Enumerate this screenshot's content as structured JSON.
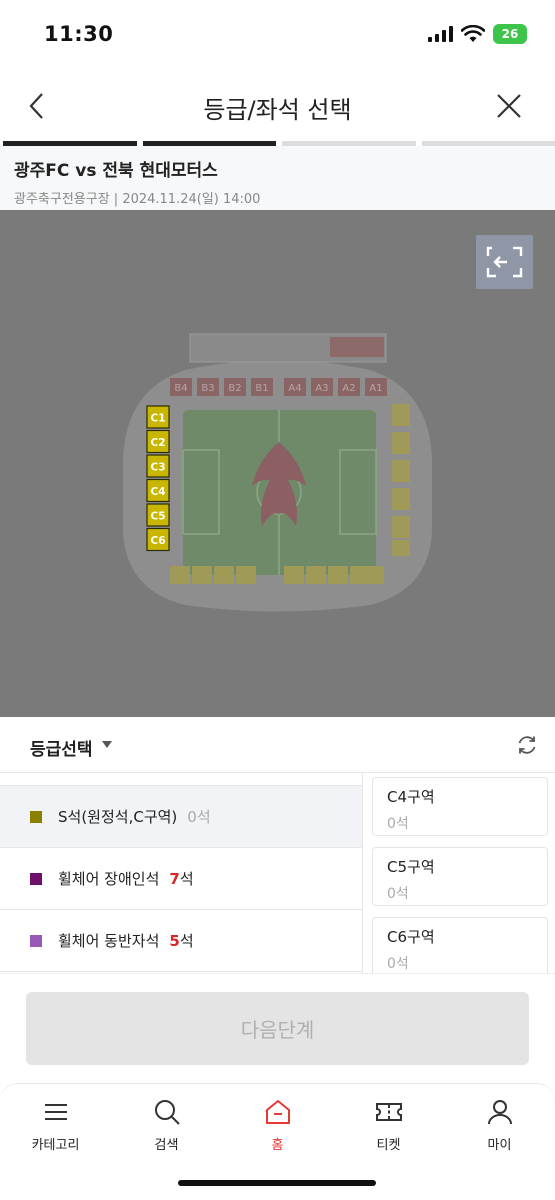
{
  "status_bar": {
    "time": "11:30",
    "battery": "26"
  },
  "header": {
    "title": "등급/좌석 선택"
  },
  "progress": {
    "steps": 4,
    "completed": 2,
    "active_color": "#222222",
    "inactive_color": "#dddddd"
  },
  "match": {
    "title": "광주FC vs 전북 현대모터스",
    "venue_datetime": "광주축구전용구장 | 2024.11.24(일) 14:00"
  },
  "stadium_map": {
    "top_blocks": [
      "B4",
      "B3",
      "B2",
      "B1",
      "A4",
      "A3",
      "A2",
      "A1"
    ],
    "left_blocks": [
      "C1",
      "C2",
      "C3",
      "C4",
      "C5",
      "C6"
    ],
    "accent_color": "#c8b600"
  },
  "grade_selector": {
    "label": "등급선택"
  },
  "grades": [
    {
      "color": "#8a8000",
      "name": "S석(원정석,C구역)",
      "count_num": "0",
      "count_unit": "석",
      "highlight": false,
      "selected": true
    },
    {
      "color": "#6d0f6d",
      "name": "휠체어 장애인석",
      "count_num": "7",
      "count_unit": "석",
      "highlight": true,
      "selected": false
    },
    {
      "color": "#9b59b6",
      "name": "휠체어 동반자석",
      "count_num": "5",
      "count_unit": "석",
      "highlight": true,
      "selected": false
    }
  ],
  "sections": [
    {
      "name": "C4구역",
      "seats": "0석"
    },
    {
      "name": "C5구역",
      "seats": "0석"
    },
    {
      "name": "C6구역",
      "seats": "0석"
    }
  ],
  "next_button": {
    "label": "다음단계"
  },
  "bottom_nav": {
    "items": [
      {
        "label": "카테고리",
        "icon": "menu-icon"
      },
      {
        "label": "검색",
        "icon": "search-icon"
      },
      {
        "label": "홈",
        "icon": "home-icon",
        "active": true
      },
      {
        "label": "티켓",
        "icon": "ticket-icon"
      },
      {
        "label": "마이",
        "icon": "user-icon"
      }
    ]
  }
}
